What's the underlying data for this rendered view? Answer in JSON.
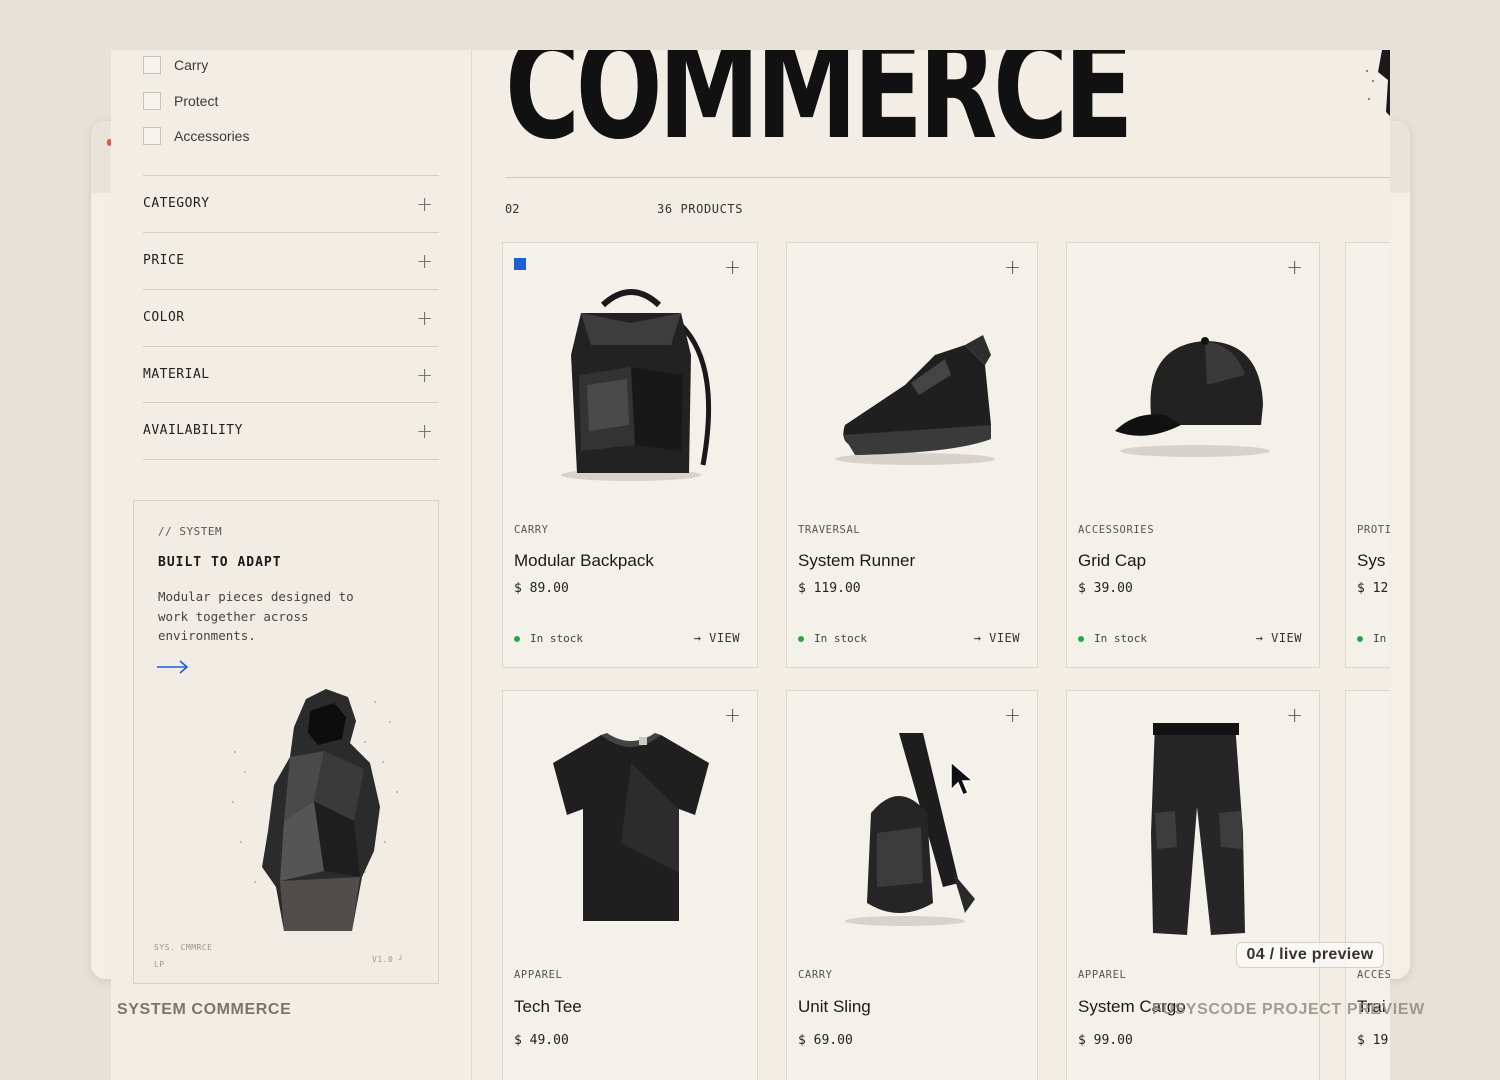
{
  "sidebar": {
    "checkboxes": [
      {
        "label": "Carry",
        "checked": false
      },
      {
        "label": "Protect",
        "checked": false
      },
      {
        "label": "Accessories",
        "checked": false
      }
    ],
    "filters": [
      "CATEGORY",
      "PRICE",
      "COLOR",
      "MATERIAL",
      "AVAILABILITY"
    ],
    "filter_icon": "plus-icon",
    "promo": {
      "tag": "// SYSTEM",
      "title": "BUILT TO ADAPT",
      "description": "Modular pieces designed to work together across environments.",
      "footer_left": "SYS. CMMRCE",
      "footer_left_2": "LP",
      "footer_right": "V1.0 ┘"
    }
  },
  "hero": {
    "title": "COMMERCE"
  },
  "listing": {
    "section_number": "02",
    "product_count": "36 PRODUCTS"
  },
  "products": [
    {
      "category": "CARRY",
      "name": "Modular Backpack",
      "price": "$ 89.00",
      "stock": "In stock",
      "view": "VIEW",
      "selected": true
    },
    {
      "category": "TRAVERSAL",
      "name": "System Runner",
      "price": "$ 119.00",
      "stock": "In stock",
      "view": "VIEW"
    },
    {
      "category": "ACCESSORIES",
      "name": "Grid Cap",
      "price": "$ 39.00",
      "stock": "In stock",
      "view": "VIEW"
    },
    {
      "category": "PROTI",
      "name": "Sys",
      "price": "$ 12",
      "stock": "In",
      "view": ""
    },
    {
      "category": "APPAREL",
      "name": "Tech Tee",
      "price": "$ 49.00"
    },
    {
      "category": "CARRY",
      "name": "Unit Sling",
      "price": "$ 69.00"
    },
    {
      "category": "APPAREL",
      "name": "System Cargo",
      "price": "$ 99.00"
    },
    {
      "category": "ACCES",
      "name": "Trai",
      "price": "$ 19"
    }
  ],
  "colors": {
    "accent": "#1f5fd6",
    "in_stock": "#28a745",
    "background": "#f2eee6"
  },
  "overlay": {
    "badge": "04 / live preview",
    "caption_left": "SYSTEM COMMERCE",
    "caption_right": "FUSYSCODE PROJECT PREVIEW"
  }
}
